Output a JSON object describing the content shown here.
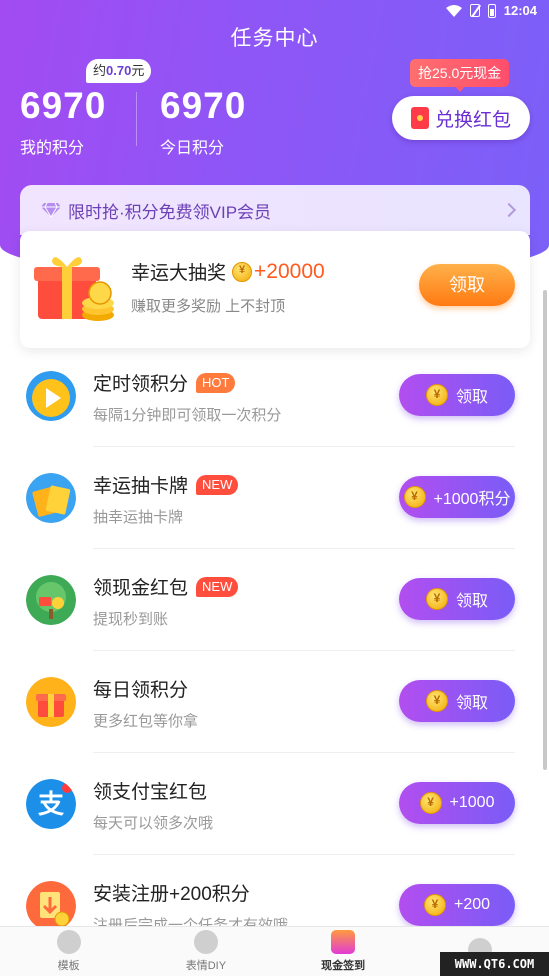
{
  "status_bar": {
    "time": "12:04"
  },
  "header": {
    "title": "任务中心",
    "approx_prefix": "约",
    "approx_value": "0.70",
    "approx_unit": "元",
    "my_points_value": "6970",
    "my_points_label": "我的积分",
    "today_points_value": "6970",
    "today_points_label": "今日积分",
    "cash_tag": "抢25.0元现金",
    "redeem_label": "兑换红包"
  },
  "vip_banner": {
    "text": "限时抢·积分免费领VIP会员"
  },
  "lottery": {
    "title": "幸运大抽奖",
    "bonus": "+20000",
    "subtitle": "赚取更多奖励 上不封顶",
    "button": "领取"
  },
  "tasks": [
    {
      "title": "定时领积分",
      "badge": "HOT",
      "subtitle": "每隔1分钟即可领取一次积分",
      "button": "领取",
      "icon": "play-icon"
    },
    {
      "title": "幸运抽卡牌",
      "badge": "NEW",
      "subtitle": "抽幸运抽卡牌",
      "button": "+1000积分",
      "icon": "cards-icon"
    },
    {
      "title": "领现金红包",
      "badge": "NEW",
      "subtitle": "提现秒到账",
      "button": "领取",
      "icon": "money-tree-icon"
    },
    {
      "title": "每日领积分",
      "badge": "",
      "subtitle": "更多红包等你拿",
      "button": "领取",
      "icon": "gift-box-icon"
    },
    {
      "title": "领支付宝红包",
      "badge": "",
      "subtitle": "每天可以领多次哦",
      "button": "+1000",
      "icon": "alipay-icon"
    },
    {
      "title": "安装注册+200积分",
      "badge": "",
      "subtitle": "注册后完成一个任务才有效哦",
      "button": "+200",
      "icon": "download-icon"
    }
  ],
  "tabbar": {
    "items": [
      {
        "label": "模板"
      },
      {
        "label": "表情DIY"
      },
      {
        "label": "现金签到"
      },
      {
        "label": ""
      }
    ]
  },
  "watermark": "WWW.QT6.COM",
  "colors": {
    "accent": "#8e56f6",
    "orange": "#ff7a12",
    "red": "#ff4e3d"
  }
}
